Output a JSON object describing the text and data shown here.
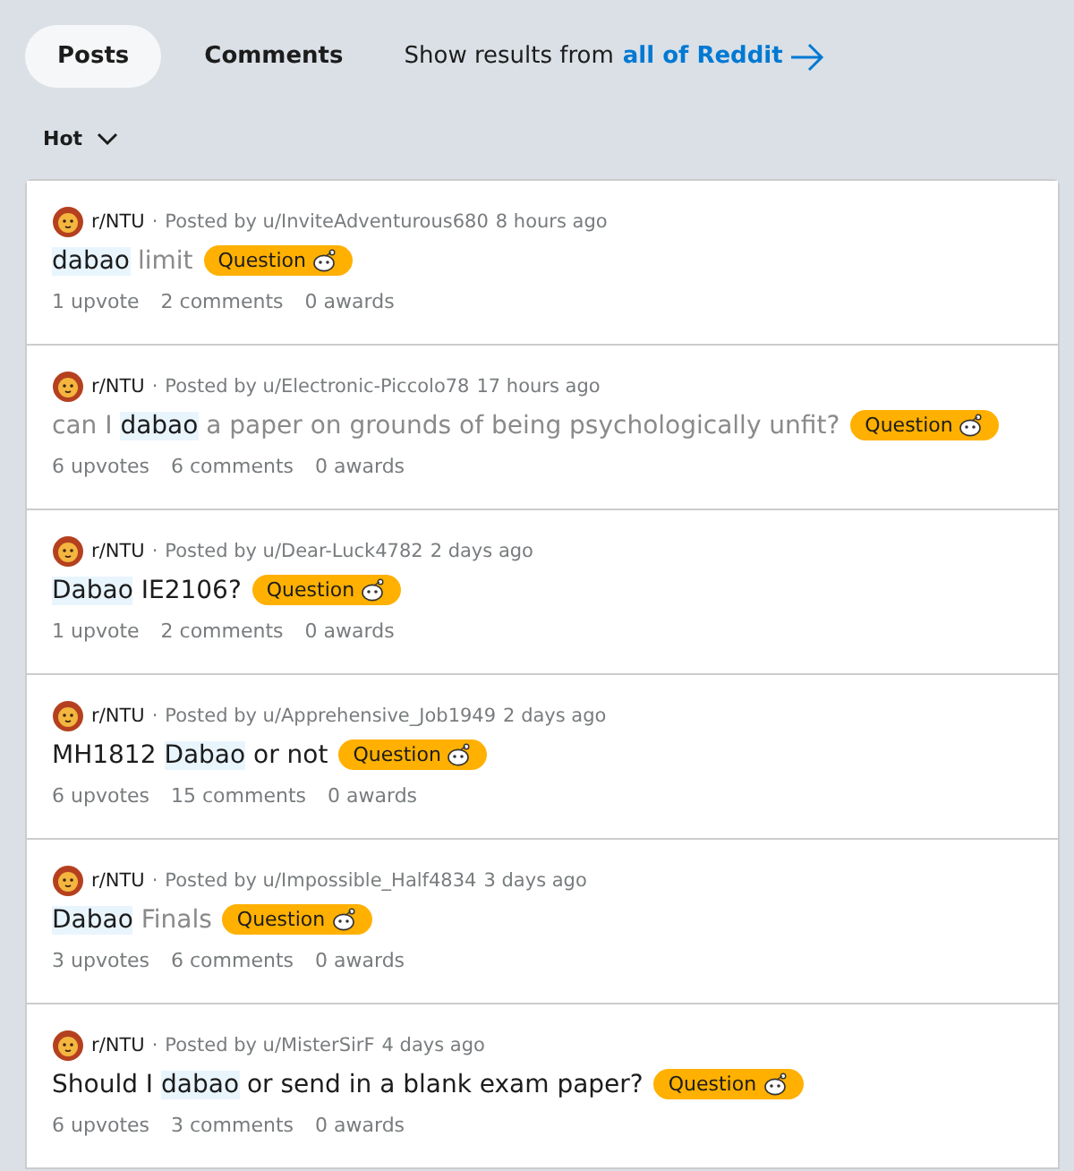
{
  "tabs": [
    {
      "label": "Posts",
      "selected": true
    },
    {
      "label": "Comments",
      "selected": false
    }
  ],
  "scope": {
    "prefix": "Show results from",
    "link": "all of Reddit"
  },
  "sort": {
    "label": "Hot"
  },
  "posts": [
    {
      "subreddit": "r/NTU",
      "separator": "·",
      "posted_by": "Posted by u/InviteAdventurous680",
      "time": "8 hours ago",
      "visited": true,
      "title": [
        {
          "text": "dabao",
          "highlighted": true
        },
        {
          "text": " limit",
          "highlighted": false
        }
      ],
      "flair": "Question",
      "upvotes": "1 upvote",
      "comments": "2 comments",
      "awards": "0 awards"
    },
    {
      "subreddit": "r/NTU",
      "separator": "·",
      "posted_by": "Posted by u/Electronic-Piccolo78",
      "time": "17 hours ago",
      "visited": true,
      "title": [
        {
          "text": "can I ",
          "highlighted": false
        },
        {
          "text": "dabao",
          "highlighted": true
        },
        {
          "text": " a paper on grounds of being psychologically unfit?",
          "highlighted": false
        }
      ],
      "flair": "Question",
      "upvotes": "6 upvotes",
      "comments": "6 comments",
      "awards": "0 awards"
    },
    {
      "subreddit": "r/NTU",
      "separator": "·",
      "posted_by": "Posted by u/Dear-Luck4782",
      "time": "2 days ago",
      "visited": false,
      "title": [
        {
          "text": "Dabao",
          "highlighted": true
        },
        {
          "text": " IE2106?",
          "highlighted": false
        }
      ],
      "flair": "Question",
      "upvotes": "1 upvote",
      "comments": "2 comments",
      "awards": "0 awards"
    },
    {
      "subreddit": "r/NTU",
      "separator": "·",
      "posted_by": "Posted by u/Apprehensive_Job1949",
      "time": "2 days ago",
      "visited": false,
      "title": [
        {
          "text": "MH1812 ",
          "highlighted": false
        },
        {
          "text": "Dabao",
          "highlighted": true
        },
        {
          "text": " or not",
          "highlighted": false
        }
      ],
      "flair": "Question",
      "upvotes": "6 upvotes",
      "comments": "15 comments",
      "awards": "0 awards"
    },
    {
      "subreddit": "r/NTU",
      "separator": "·",
      "posted_by": "Posted by u/Impossible_Half4834",
      "time": "3 days ago",
      "visited": true,
      "title": [
        {
          "text": "Dabao",
          "highlighted": true
        },
        {
          "text": " Finals",
          "highlighted": false
        }
      ],
      "flair": "Question",
      "upvotes": "3 upvotes",
      "comments": "6 comments",
      "awards": "0 awards"
    },
    {
      "subreddit": "r/NTU",
      "separator": "·",
      "posted_by": "Posted by u/MisterSirF",
      "time": "4 days ago",
      "visited": false,
      "title": [
        {
          "text": "Should I ",
          "highlighted": false
        },
        {
          "text": "dabao",
          "highlighted": true
        },
        {
          "text": " or send in a blank exam paper?",
          "highlighted": false
        }
      ],
      "flair": "Question",
      "upvotes": "6 upvotes",
      "comments": "3 comments",
      "awards": "0 awards"
    }
  ]
}
